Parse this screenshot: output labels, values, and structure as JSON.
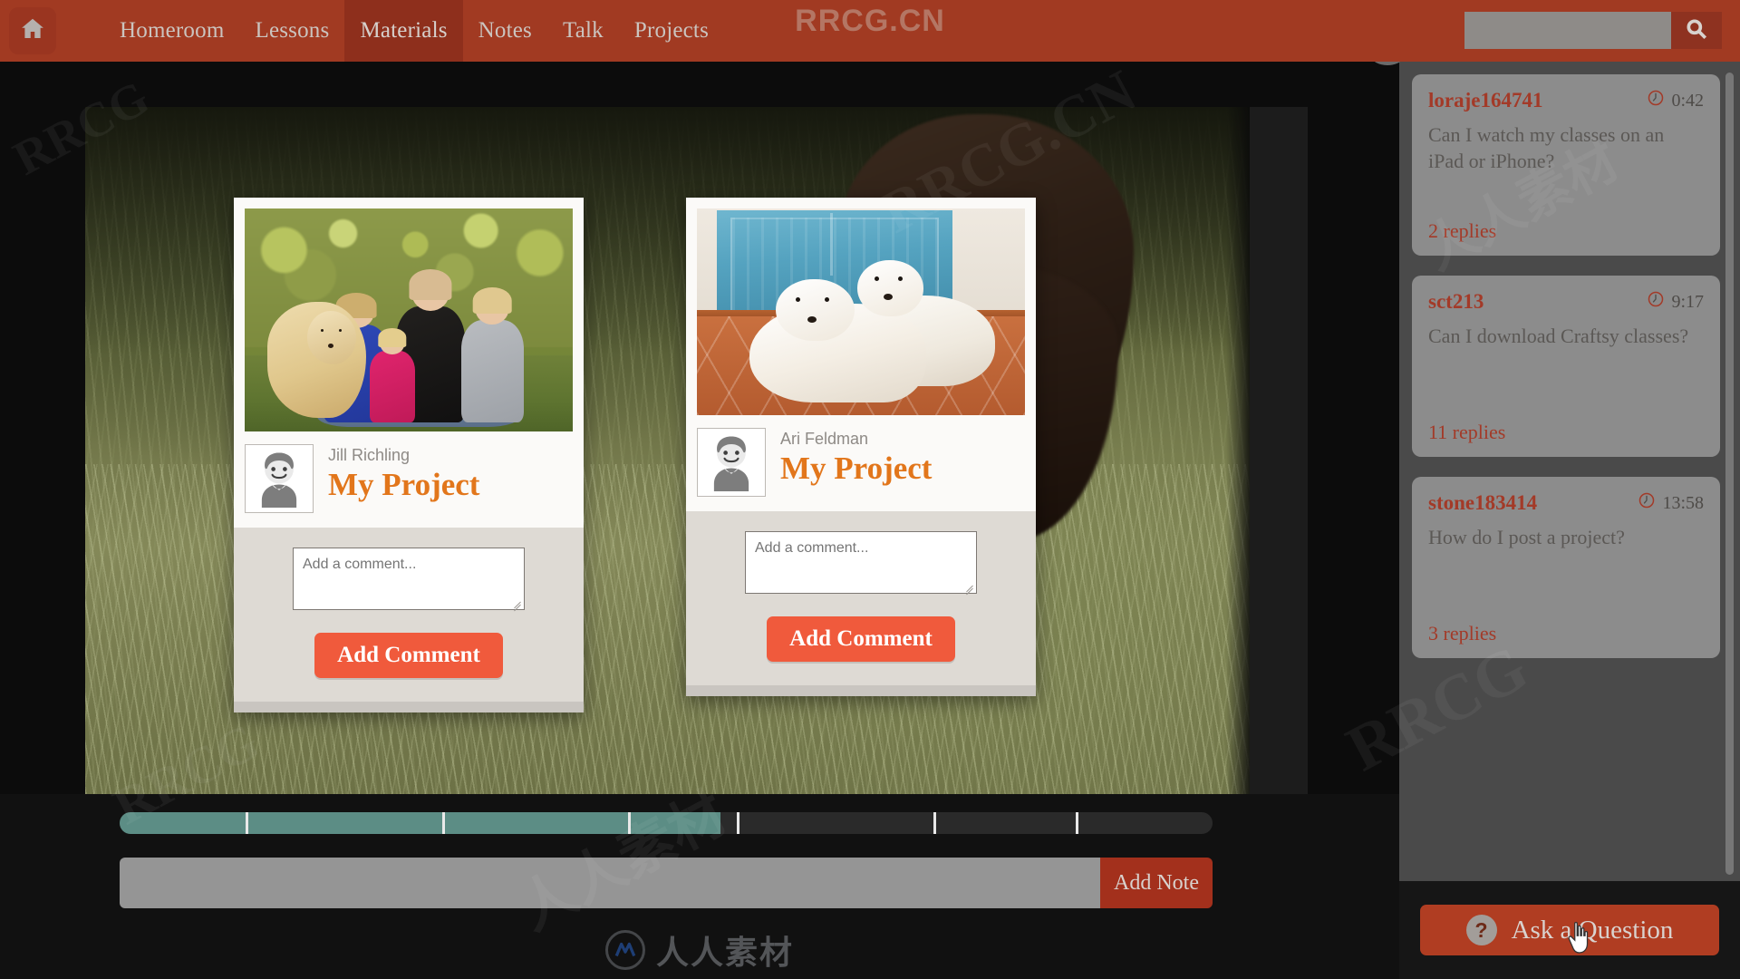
{
  "nav": {
    "home_icon": "home-icon",
    "items": [
      {
        "label": "Homeroom",
        "active": false
      },
      {
        "label": "Lessons",
        "active": false
      },
      {
        "label": "Materials",
        "active": true
      },
      {
        "label": "Notes",
        "active": false
      },
      {
        "label": "Talk",
        "active": false
      },
      {
        "label": "Projects",
        "active": false
      }
    ],
    "brand_watermark": "RRCG.CN",
    "search": {
      "value": "",
      "placeholder": "",
      "icon": "search-icon"
    },
    "bg_color": "#a13a22",
    "active_bg_color": "#8e2f1c"
  },
  "projects": [
    {
      "author": "Jill Richling",
      "title": "My Project",
      "comment_placeholder": "Add a comment...",
      "comment_value": "",
      "add_comment_label": "Add Comment",
      "photo_alt": "family-with-golden-retriever-photo",
      "avatar_icon": "user-avatar-icon"
    },
    {
      "author": "Ari Feldman",
      "title": "My Project",
      "comment_placeholder": "Add a comment...",
      "comment_value": "",
      "add_comment_label": "Add Comment",
      "photo_alt": "two-white-golden-retrievers-photo",
      "avatar_icon": "user-avatar-icon"
    }
  ],
  "player": {
    "progress_percent": 55,
    "progress_fill_color": "#5c8d85",
    "chapter_marks_percent": [
      11.5,
      29.5,
      46.5,
      56.5,
      74.5,
      87.5
    ],
    "note_input_value": "",
    "note_input_placeholder": "",
    "add_note_label": "Add Note"
  },
  "watermark": {
    "logo_text": "人人素材",
    "logo_icon": "rrcg-logo-icon"
  },
  "qa_panel": {
    "collapse_icon": "double-chevron-right-icon",
    "cards": [
      {
        "user": "loraje164741",
        "time": "0:42",
        "clock_icon": "clock-icon",
        "question": "Can I watch my classes on an iPad or iPhone?",
        "replies": "2 replies"
      },
      {
        "user": "sct213",
        "time": "9:17",
        "clock_icon": "clock-icon",
        "question": "Can I download Craftsy classes?",
        "replies": "11 replies"
      },
      {
        "user": "stone183414",
        "time": "13:58",
        "clock_icon": "clock-icon",
        "question": "How do I post a project?",
        "replies": "3 replies"
      }
    ],
    "ask_button_label": "Ask a Question",
    "ask_button_icon": "question-mark-icon",
    "ask_button_color": "#b03d22",
    "accent_color": "#a33a28"
  },
  "page_watermarks": [
    "RRCG",
    "RRCG.CN",
    "人人素材",
    "RRCG",
    "RRCG",
    "人人素材"
  ]
}
